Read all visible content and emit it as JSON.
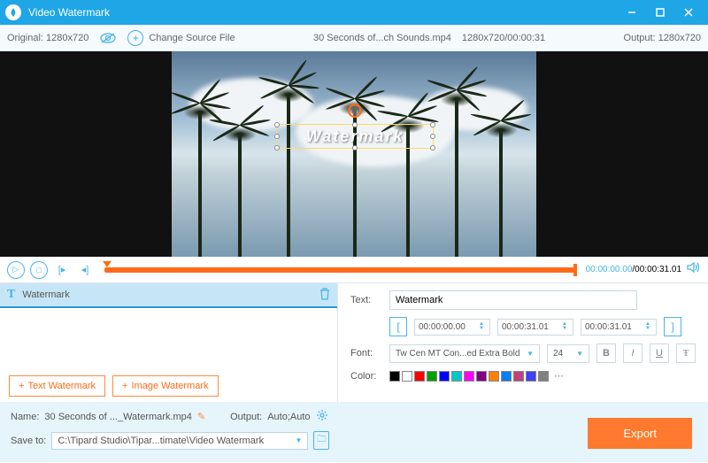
{
  "app": {
    "title": "Video Watermark"
  },
  "toolbar": {
    "original": "Original: 1280x720",
    "change_source": "Change Source File",
    "filename": "30 Seconds of...ch Sounds.mp4",
    "dimensions_time": "1280x720/00:00:31",
    "output": "Output: 1280x720"
  },
  "watermark_overlay": {
    "text": "Watermark"
  },
  "playback": {
    "current_time": "00:00:00.00",
    "total_time": "00:00:31.01"
  },
  "watermark_list": {
    "items": [
      {
        "label": "Watermark"
      }
    ]
  },
  "buttons": {
    "text_watermark": "Text Watermark",
    "image_watermark": "Image Watermark"
  },
  "properties": {
    "text_label": "Text:",
    "text_value": "Watermark",
    "time_start": "00:00:00.00",
    "time_end": "00:00:31.01",
    "time_dur": "00:00:31.01",
    "font_label": "Font:",
    "font_value": "Tw Cen MT Con...ed Extra Bold",
    "font_size": "24",
    "color_label": "Color:",
    "colors": [
      "#000000",
      "#ffffff",
      "#ff0000",
      "#00a000",
      "#0000ff",
      "#00c8c8",
      "#ff00ff",
      "#800080",
      "#ff8000",
      "#0080ff",
      "#c04080",
      "#4040ff",
      "#808080"
    ]
  },
  "footer": {
    "name_label": "Name:",
    "name_value": "30 Seconds of ..._Watermark.mp4",
    "output_label": "Output:",
    "output_value": "Auto;Auto",
    "saveto_label": "Save to:",
    "saveto_value": "C:\\Tipard Studio\\Tipar...timate\\Video Watermark",
    "export": "Export"
  }
}
